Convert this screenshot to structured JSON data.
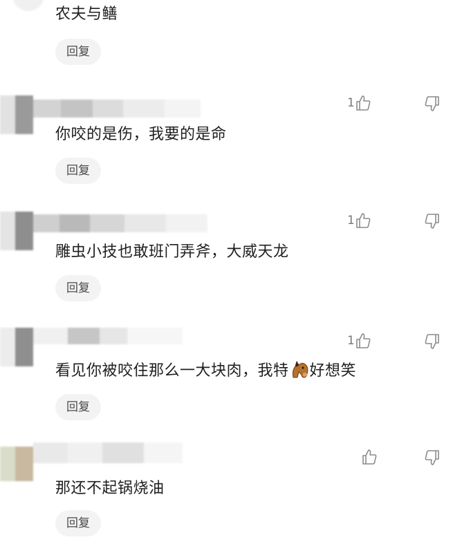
{
  "reply_label": "回复",
  "comments": [
    {
      "text": "农夫与鳝",
      "likes": ""
    },
    {
      "text": "你咬的是伤，我要的是命",
      "likes": "1"
    },
    {
      "text": "雕虫小技也敢班门弄斧，大威天龙",
      "likes": "1"
    },
    {
      "text_before": "看见你被咬住那么一大块肉，我特",
      "emoji": "horse",
      "text_after": "好想笑",
      "likes": "1"
    },
    {
      "text": "那还不起锅烧油",
      "likes": ""
    }
  ],
  "icons": {
    "like": "thumbs-up-icon",
    "dislike": "thumbs-down-icon",
    "emoji": "horse-face-icon"
  },
  "colors": {
    "reply_bg": "#f3f3f3",
    "icon_stroke": "#8a8a8a"
  }
}
